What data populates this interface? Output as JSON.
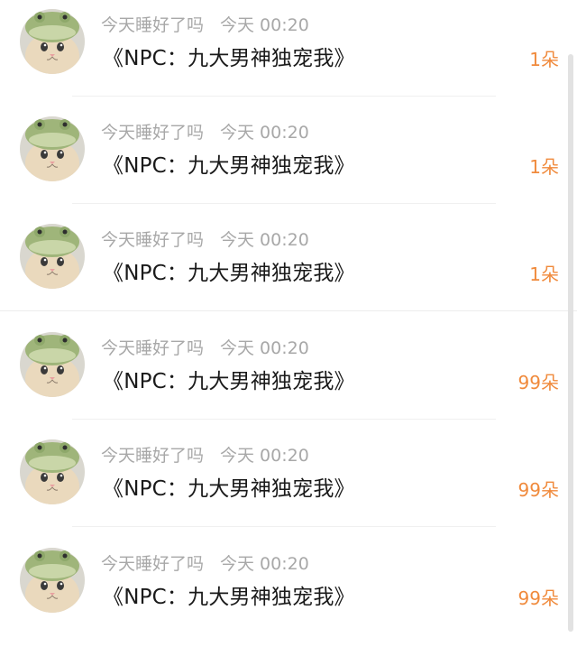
{
  "items": [
    {
      "username": "今天睡好了吗",
      "time": "今天 00:20",
      "title": "《NPC：九大男神独宠我》",
      "flowers": "1朵",
      "avatar_icon": "cat-frog-hat-avatar"
    },
    {
      "username": "今天睡好了吗",
      "time": "今天 00:20",
      "title": "《NPC：九大男神独宠我》",
      "flowers": "1朵",
      "avatar_icon": "cat-frog-hat-avatar"
    },
    {
      "username": "今天睡好了吗",
      "time": "今天 00:20",
      "title": "《NPC：九大男神独宠我》",
      "flowers": "1朵",
      "avatar_icon": "cat-frog-hat-avatar"
    },
    {
      "username": "今天睡好了吗",
      "time": "今天 00:20",
      "title": "《NPC：九大男神独宠我》",
      "flowers": "99朵",
      "avatar_icon": "cat-frog-hat-avatar"
    },
    {
      "username": "今天睡好了吗",
      "time": "今天 00:20",
      "title": "《NPC：九大男神独宠我》",
      "flowers": "99朵",
      "avatar_icon": "cat-frog-hat-avatar"
    },
    {
      "username": "今天睡好了吗",
      "time": "今天 00:20",
      "title": "《NPC：九大男神独宠我》",
      "flowers": "99朵",
      "avatar_icon": "cat-frog-hat-avatar"
    }
  ],
  "colors": {
    "meta": "#a8a8a8",
    "title": "#1a1a1a",
    "flowers": "#f08a3c",
    "divider": "#f0f0f0"
  }
}
